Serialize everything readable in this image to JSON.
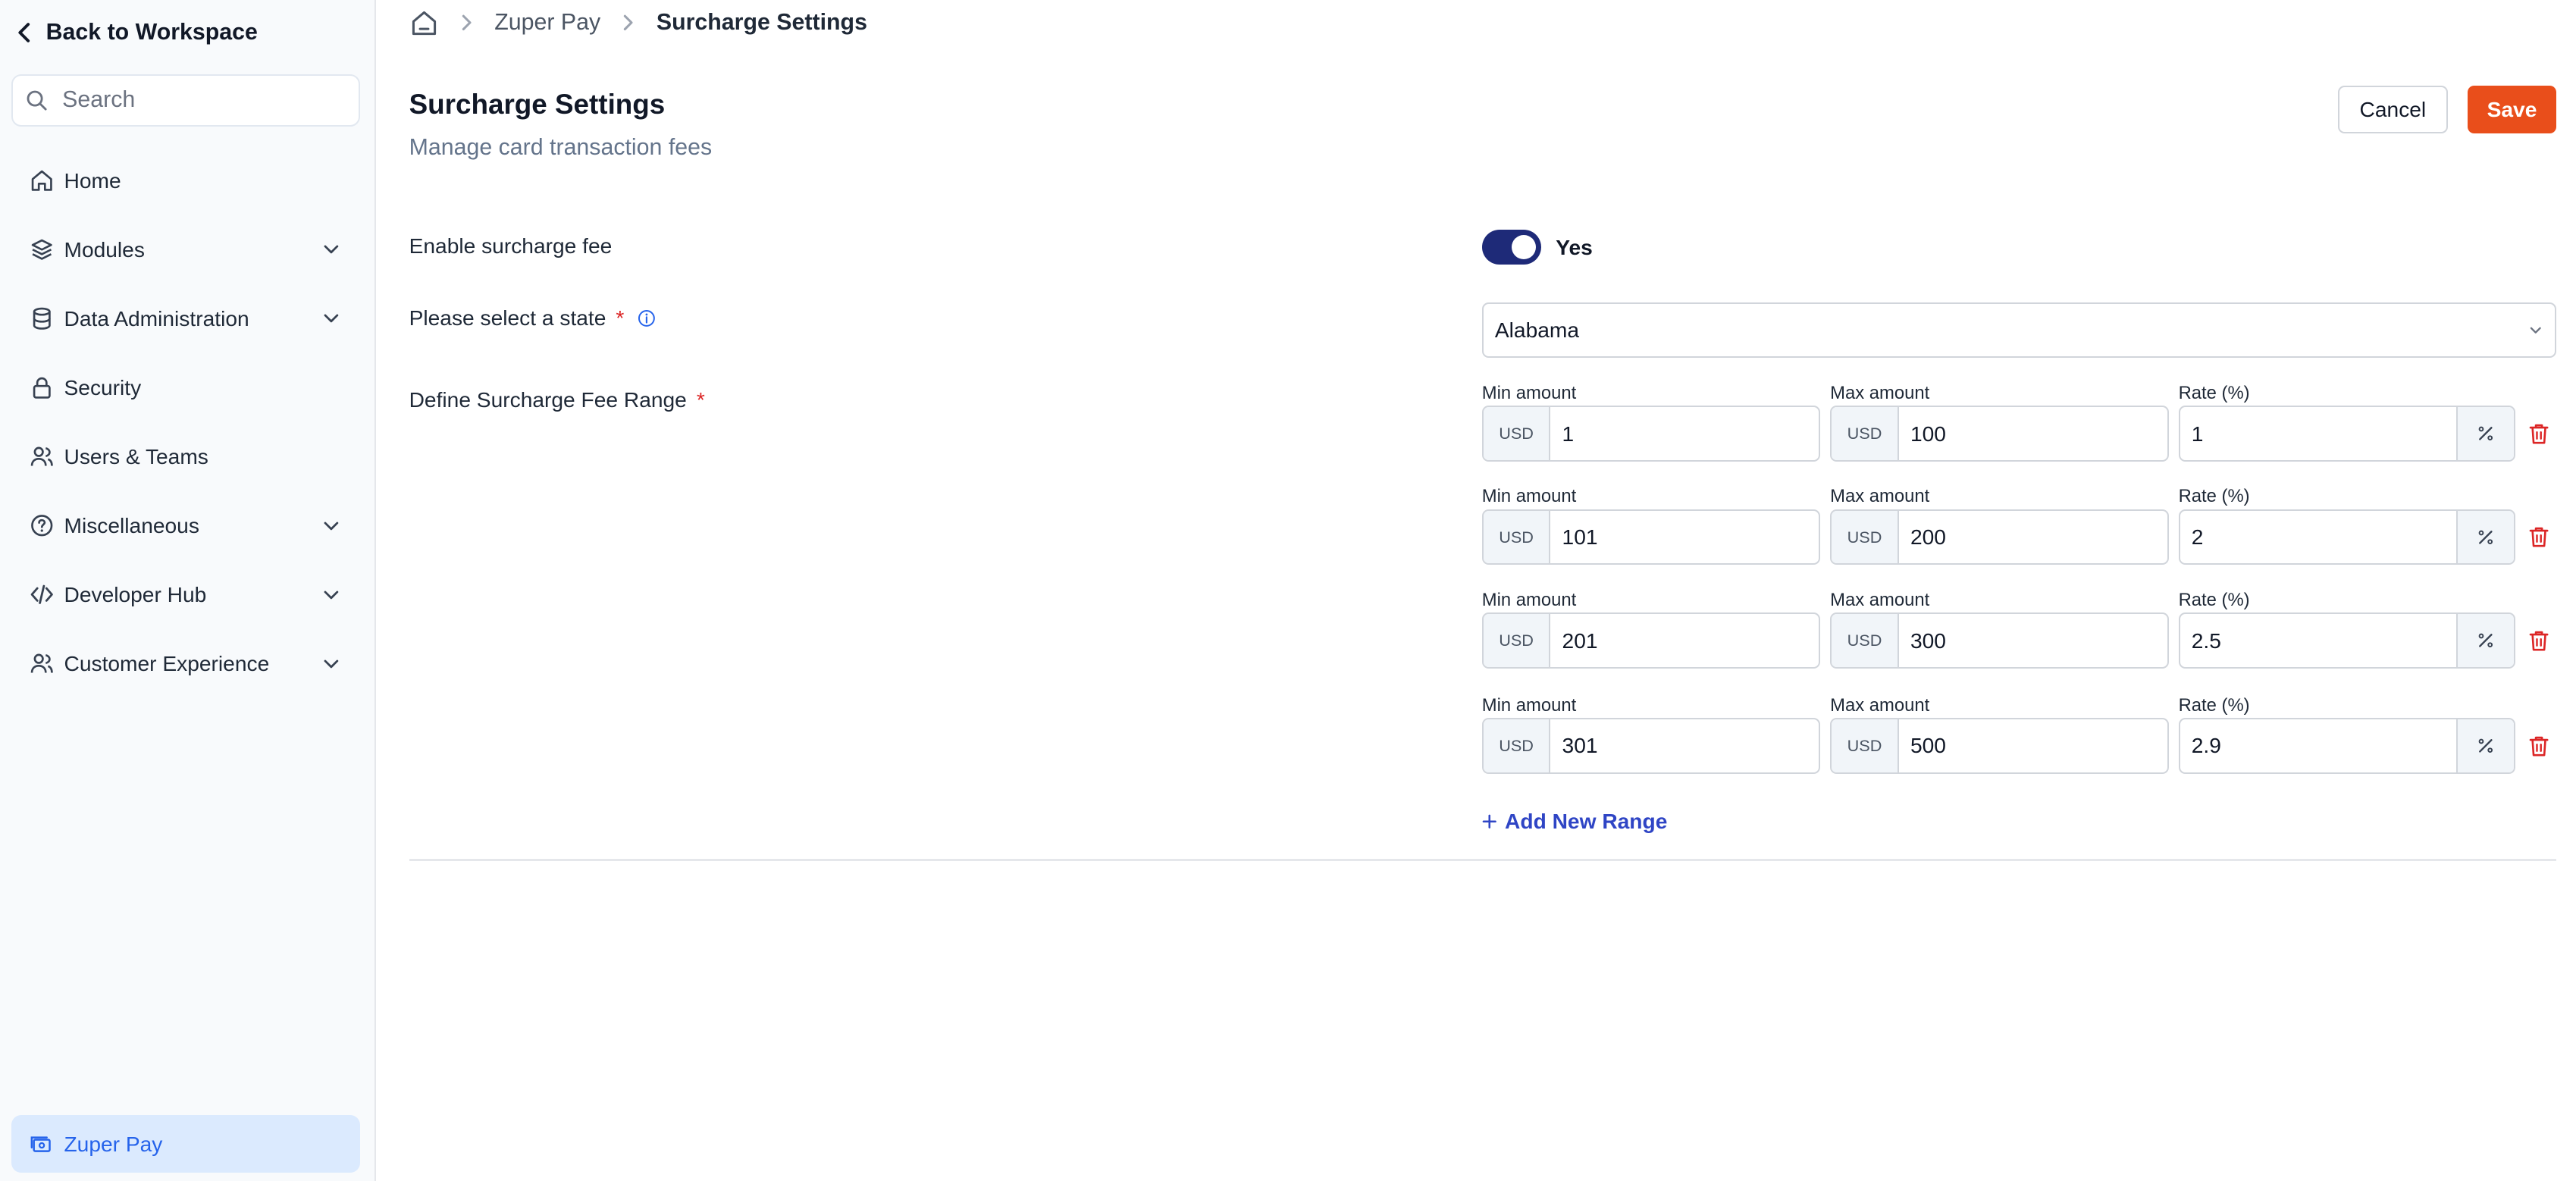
{
  "sidebar": {
    "back_label": "Back to Workspace",
    "search_placeholder": "Search",
    "items": [
      {
        "label": "Home",
        "icon": "home-icon",
        "expandable": false
      },
      {
        "label": "Modules",
        "icon": "layers-icon",
        "expandable": true
      },
      {
        "label": "Data Administration",
        "icon": "database-icon",
        "expandable": true
      },
      {
        "label": "Security",
        "icon": "lock-icon",
        "expandable": false
      },
      {
        "label": "Users & Teams",
        "icon": "users-icon",
        "expandable": false
      },
      {
        "label": "Miscellaneous",
        "icon": "help-circle-icon",
        "expandable": true
      },
      {
        "label": "Developer Hub",
        "icon": "code-icon",
        "expandable": true
      },
      {
        "label": "Customer Experience",
        "icon": "users-icon",
        "expandable": true
      }
    ],
    "footer_label": "Zuper Pay"
  },
  "breadcrumb": {
    "items": [
      "Zuper Pay",
      "Surcharge Settings"
    ]
  },
  "header": {
    "title": "Surcharge Settings",
    "subtitle": "Manage card transaction fees",
    "cancel_label": "Cancel",
    "save_label": "Save"
  },
  "form": {
    "enable_label": "Enable surcharge fee",
    "enable_state": "Yes",
    "state_label": "Please select a state",
    "state_required": "*",
    "state_value": "Alabama",
    "range_label": "Define Surcharge Fee Range",
    "range_required": "*",
    "min_label": "Min amount",
    "max_label": "Max amount",
    "rate_label": "Rate (%)",
    "currency": "USD",
    "ranges": [
      {
        "min": "1",
        "max": "100",
        "rate": "1"
      },
      {
        "min": "101",
        "max": "200",
        "rate": "2"
      },
      {
        "min": "201",
        "max": "300",
        "rate": "2.5"
      },
      {
        "min": "301",
        "max": "500",
        "rate": "2.9"
      }
    ],
    "add_label": "Add New Range"
  },
  "colors": {
    "accent": "#e94e1b",
    "toggle": "#1e2a78",
    "link": "#2f45c5",
    "active_nav_bg": "#dbeafe",
    "danger": "#dc2626"
  }
}
